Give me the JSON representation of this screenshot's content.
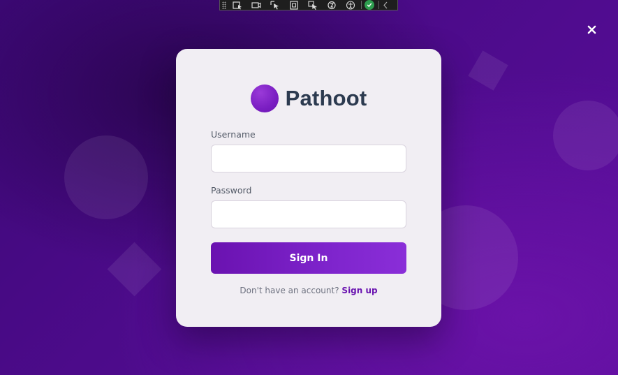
{
  "brand": {
    "name": "Pathoot",
    "logo_color": "#7a1ec2"
  },
  "form": {
    "username_label": "Username",
    "username_value": "",
    "password_label": "Password",
    "password_value": "",
    "submit_label": "Sign In"
  },
  "footer": {
    "prompt": "Don't have an account?",
    "signup_label": "Sign up"
  },
  "overlay": {
    "close_symbol": "✕"
  },
  "toolbar": {
    "icons": [
      "grip-icon",
      "select-element-icon",
      "video-icon",
      "pointer-select-icon",
      "frame-icon",
      "pointer-frame-icon",
      "hot-reload-icon",
      "accessibility-icon",
      "check-icon",
      "collapse-chevron-icon"
    ]
  },
  "colors": {
    "background": "#4c0b8a",
    "card": "#f1eef3",
    "accent": "#7e24cc",
    "title_text": "#2c3a4f"
  }
}
